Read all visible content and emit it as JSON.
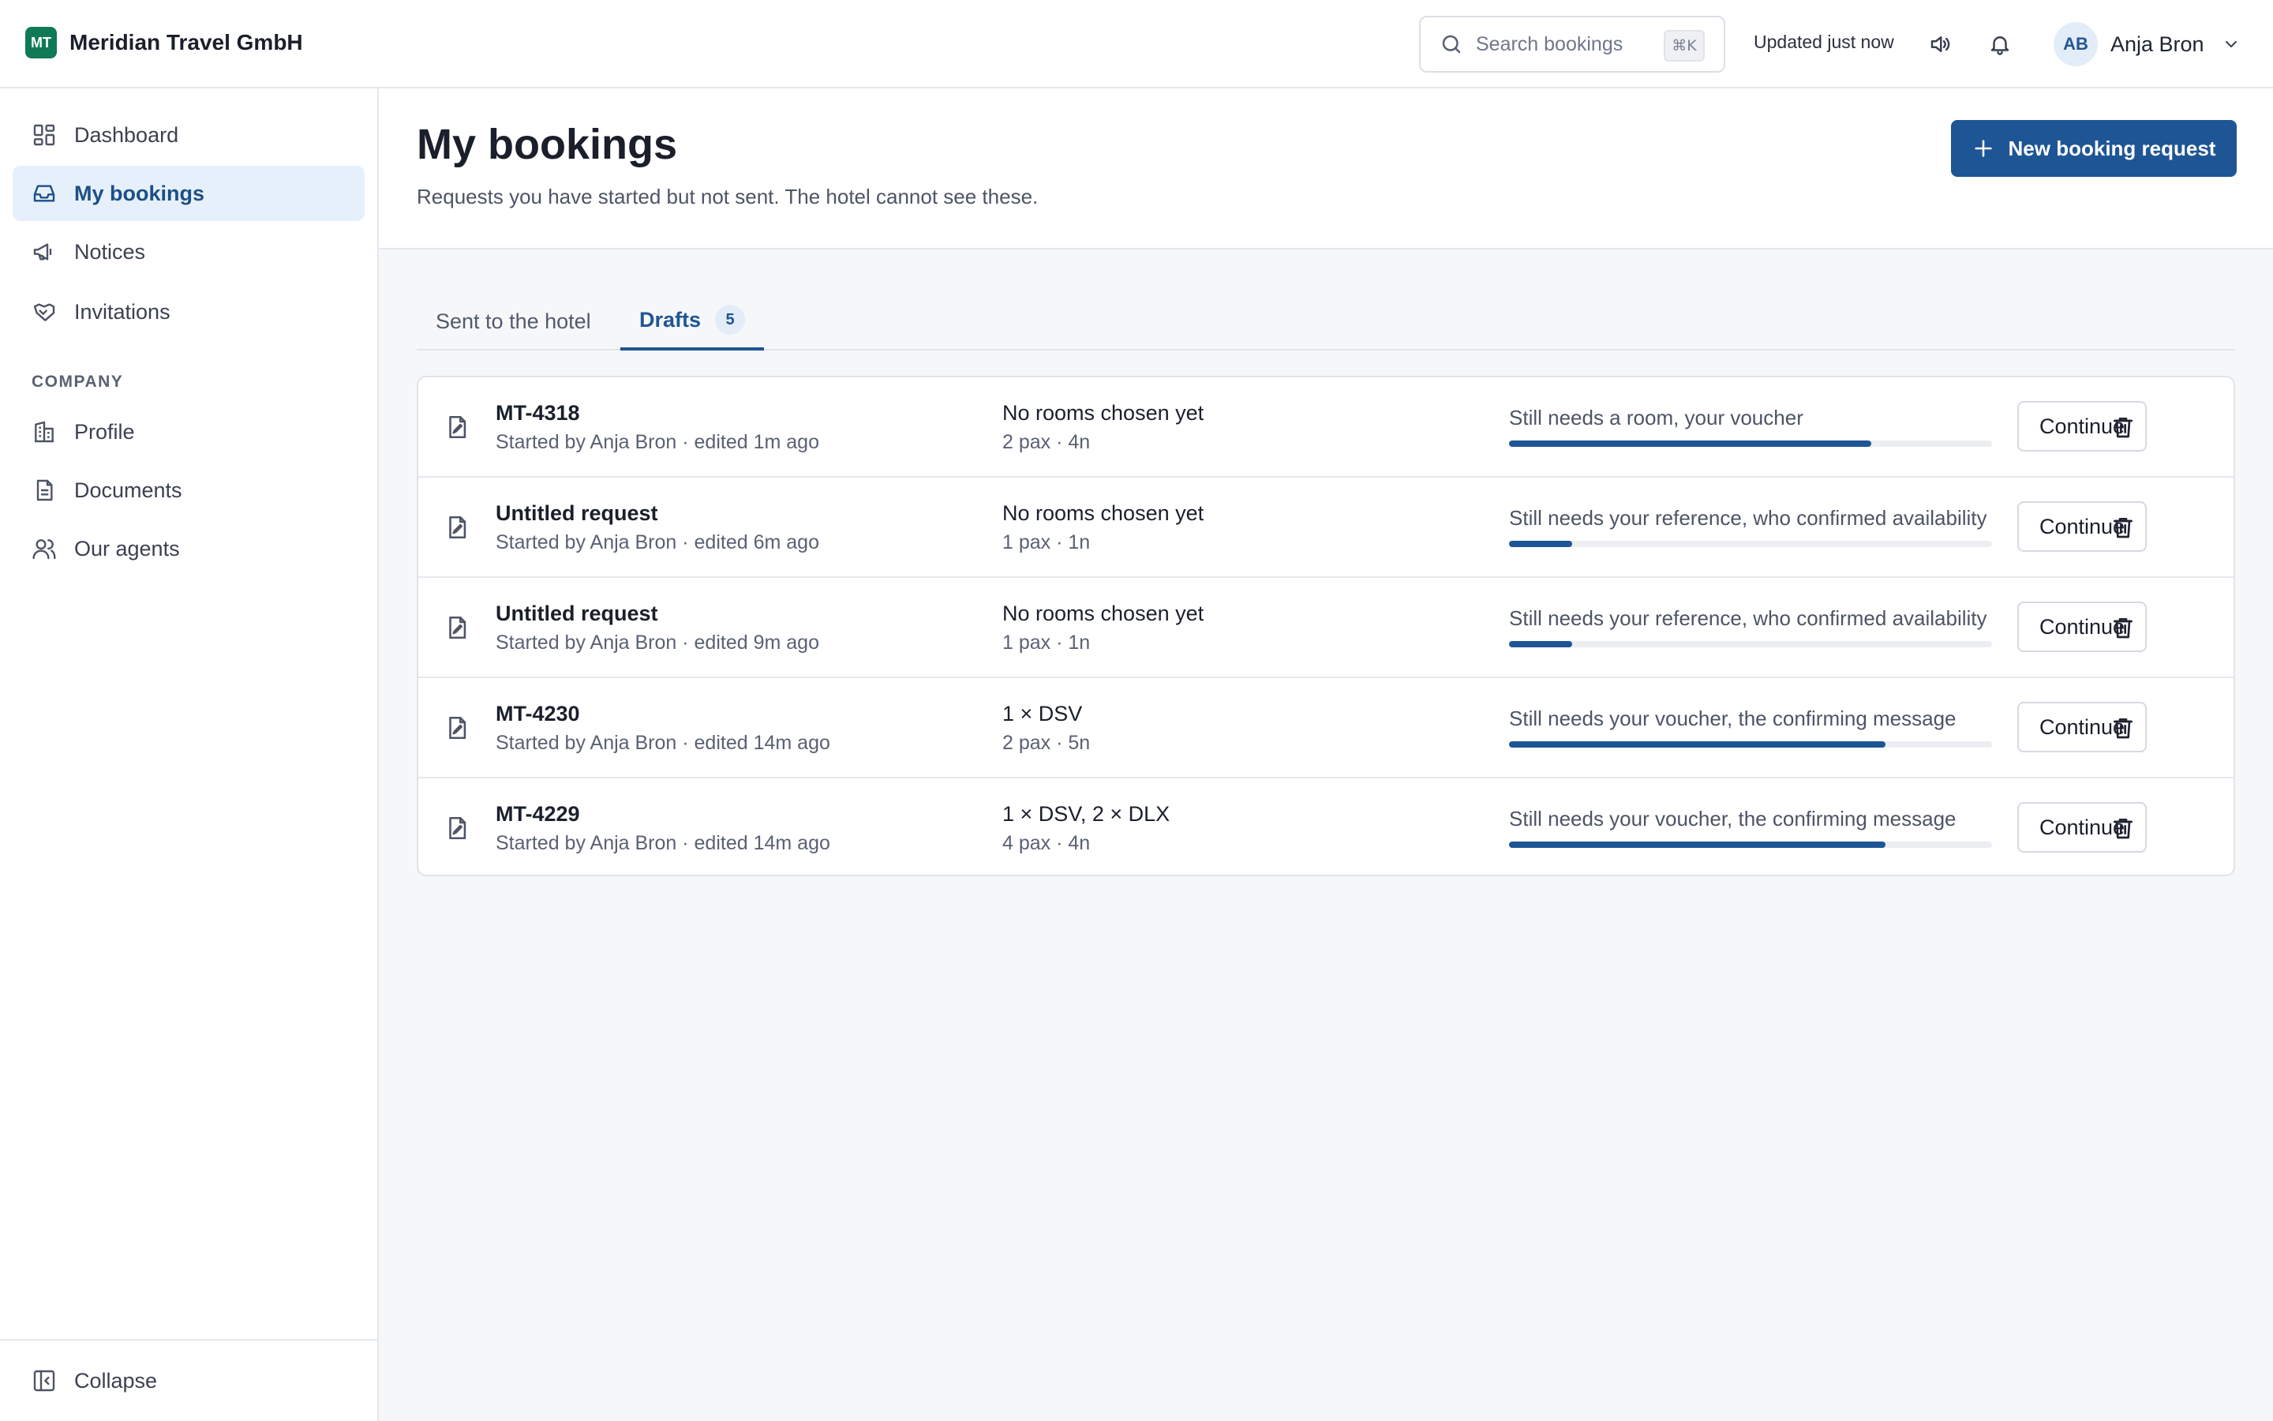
{
  "brand": {
    "initials": "MT",
    "name": "Meridian Travel GmbH",
    "color": "#0f7a55"
  },
  "header": {
    "search_placeholder": "Search bookings",
    "search_shortcut": "⌘K",
    "updated": "Updated just now",
    "user_initials": "AB",
    "user_name": "Anja Bron"
  },
  "sidebar": {
    "items": [
      {
        "label": "Dashboard",
        "icon": "dashboard-icon"
      },
      {
        "label": "My bookings",
        "icon": "inbox-icon",
        "active": true
      },
      {
        "label": "Notices",
        "icon": "megaphone-icon"
      },
      {
        "label": "Invitations",
        "icon": "handshake-icon"
      }
    ],
    "section_label": "COMPANY",
    "company_items": [
      {
        "label": "Profile",
        "icon": "building-icon"
      },
      {
        "label": "Documents",
        "icon": "document-icon"
      },
      {
        "label": "Our agents",
        "icon": "users-icon"
      }
    ],
    "collapse_label": "Collapse"
  },
  "page": {
    "title": "My bookings",
    "subtitle": "Requests you have started but not sent. The hotel cannot see these.",
    "new_button": "New booking request"
  },
  "tabs": [
    {
      "label": "Sent to the hotel",
      "active": false
    },
    {
      "label": "Drafts",
      "badge": "5",
      "active": true
    }
  ],
  "drafts": [
    {
      "title": "MT-4318",
      "meta": "Started by Anja Bron · edited 1m ago",
      "rooms": "No rooms chosen yet",
      "pax": "2 pax · 4n",
      "needs": "Still needs a room, your voucher",
      "progress": 0.75,
      "action": "Continue"
    },
    {
      "title": "Untitled request",
      "meta": "Started by Anja Bron · edited 6m ago",
      "rooms": "No rooms chosen yet",
      "pax": "1 pax · 1n",
      "needs": "Still needs your reference, who confirmed availability",
      "progress": 0.13,
      "action": "Continue"
    },
    {
      "title": "Untitled request",
      "meta": "Started by Anja Bron · edited 9m ago",
      "rooms": "No rooms chosen yet",
      "pax": "1 pax · 1n",
      "needs": "Still needs your reference, who confirmed availability",
      "progress": 0.13,
      "action": "Continue"
    },
    {
      "title": "MT-4230",
      "meta": "Started by Anja Bron · edited 14m ago",
      "rooms": "1 × DSV",
      "pax": "2 pax · 5n",
      "needs": "Still needs your voucher, the confirming message",
      "progress": 0.78,
      "action": "Continue"
    },
    {
      "title": "MT-4229",
      "meta": "Started by Anja Bron · edited 14m ago",
      "rooms": "1 × DSV, 2 × DLX",
      "pax": "4 pax · 4n",
      "needs": "Still needs your voucher, the confirming message",
      "progress": 0.78,
      "action": "Continue"
    }
  ],
  "accent_color": "#1e5595"
}
